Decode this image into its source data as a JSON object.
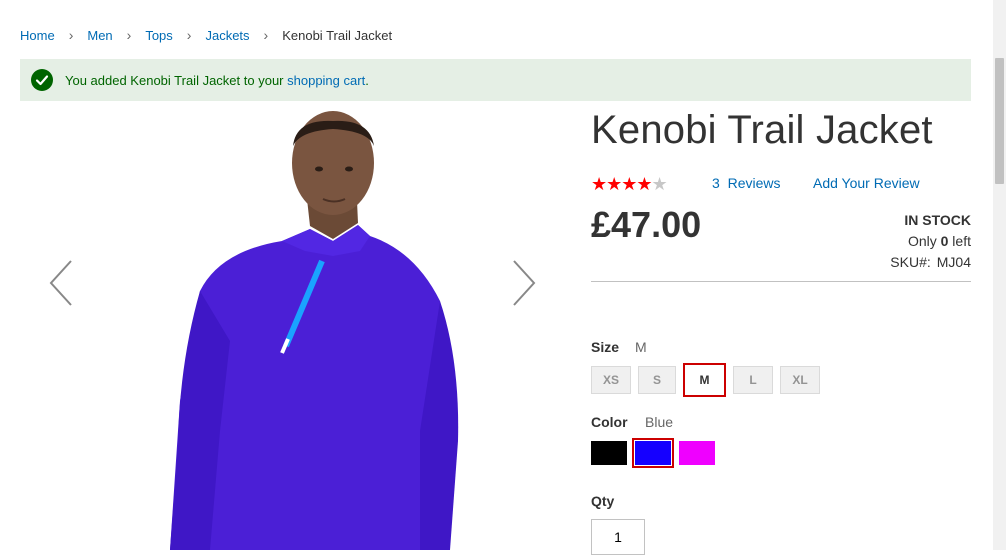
{
  "breadcrumbs": [
    {
      "label": "Home"
    },
    {
      "label": "Men"
    },
    {
      "label": "Tops"
    },
    {
      "label": "Jackets"
    },
    {
      "label": "Kenobi Trail Jacket"
    }
  ],
  "message": {
    "prefix": "You added Kenobi Trail Jacket to your ",
    "link": "shopping cart",
    "suffix": "."
  },
  "product": {
    "title": "Kenobi Trail Jacket",
    "rating_stars": 4.5,
    "reviews_count": "3",
    "reviews_label": "Reviews",
    "add_review": "Add Your Review",
    "price": "£47.00",
    "stock": "IN STOCK",
    "only_prefix": "Only ",
    "only_count": "0",
    "only_suffix": " left",
    "sku_label": "SKU#:",
    "sku": "MJ04"
  },
  "size": {
    "label": "Size",
    "selected": "M",
    "options": [
      "XS",
      "S",
      "M",
      "L",
      "XL"
    ]
  },
  "color": {
    "label": "Color",
    "selected": "Blue",
    "options": [
      {
        "name": "Black",
        "hex": "#000000"
      },
      {
        "name": "Blue",
        "hex": "#1500ff"
      },
      {
        "name": "Purple",
        "hex": "#ef00ff"
      }
    ]
  },
  "qty": {
    "label": "Qty",
    "value": "1"
  },
  "colors": {
    "link": "#006bb4",
    "success_bg": "#e5efe5",
    "success_text": "#006400",
    "selected_border": "#cc0000",
    "star": "#ff0000"
  }
}
